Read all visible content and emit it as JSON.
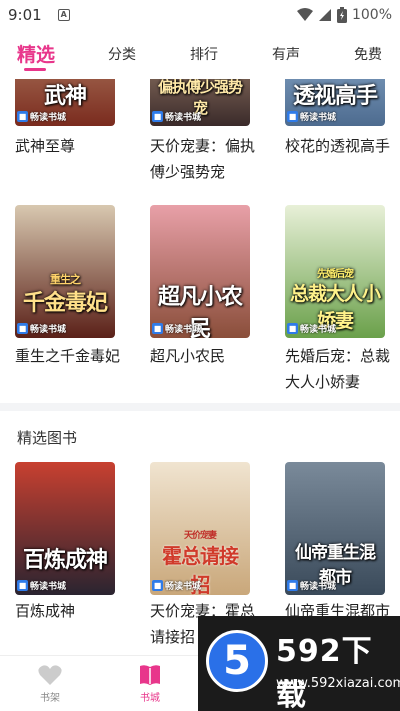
{
  "status_bar": {
    "time": "9:01",
    "notification_glyph": "A",
    "battery": "100%"
  },
  "tabs": [
    {
      "label": "精选",
      "active": true
    },
    {
      "label": "分类",
      "active": false
    },
    {
      "label": "排行",
      "active": false
    },
    {
      "label": "有声",
      "active": false
    },
    {
      "label": "免费",
      "active": false
    }
  ],
  "badge_label": "畅读书城",
  "top_row": [
    {
      "title": "武神至尊",
      "cover_text": "武神",
      "cover_color": "#7a2b1e"
    },
    {
      "title": "天价宠妻：偏执傅少强势宠",
      "cover_text": "偏执傅少强势宠",
      "cover_color": "#3a2a2a"
    },
    {
      "title": "校花的透视高手",
      "cover_text": "透视高手",
      "cover_color": "#4d6b8f"
    }
  ],
  "middle_row": [
    {
      "title": "重生之千金毒妃",
      "cover_text": "千金毒妃",
      "cover_subtitle": "重生之",
      "cover_color": "#5a2018"
    },
    {
      "title": "超凡小农民",
      "cover_text": "超凡小农民",
      "cover_color": "#8a4e3a"
    },
    {
      "title": "先婚后宠：总裁大人小娇妻",
      "cover_text": "总裁大人小娇妻",
      "cover_subtitle": "先婚后宠",
      "cover_color": "#6aa04a"
    }
  ],
  "section": {
    "title": "精选图书"
  },
  "bottom_row": [
    {
      "title": "百炼成神",
      "cover_text": "百炼成神",
      "cover_color": "#2a2430"
    },
    {
      "title": "天价宠妻：霍总请接招",
      "cover_text": "霍总请接招",
      "cover_subtitle": "天价宠妻",
      "cover_color": "#c9a77a"
    },
    {
      "title": "仙帝重生混都市",
      "cover_text": "仙帝重生混都市",
      "cover_color": "#3a4a5a"
    }
  ],
  "bottom_nav": [
    {
      "label": "书架",
      "icon": "heart-icon",
      "active": false
    },
    {
      "label": "书城",
      "icon": "book-icon",
      "active": true
    }
  ],
  "watermark": {
    "logo_digit": "5",
    "brand": "592下载",
    "url": "www.592xiazai.com"
  },
  "colors": {
    "accent": "#e8368b",
    "badge_blue": "#2f7be8",
    "divider": "#f3f4f6"
  }
}
